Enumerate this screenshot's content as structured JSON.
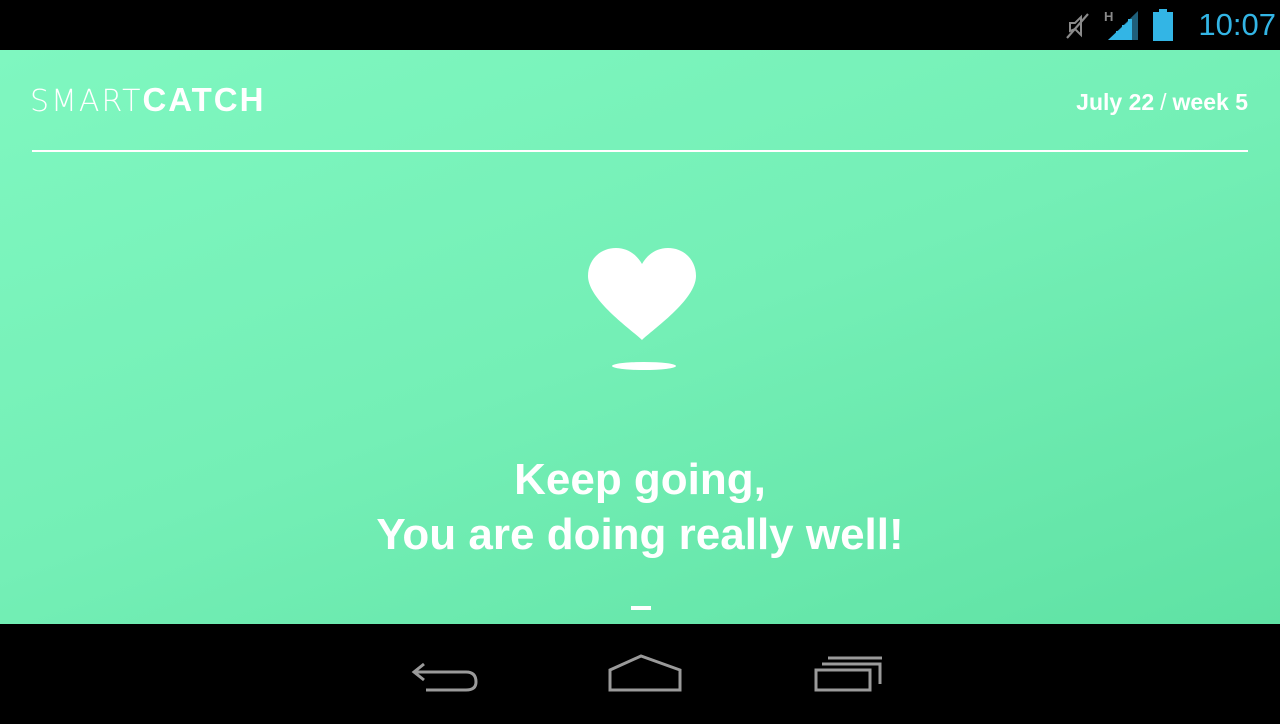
{
  "status_bar": {
    "time": "10:07",
    "network_type": "H",
    "icons": [
      "mute-icon",
      "signal-icon",
      "battery-icon"
    ],
    "clock_color": "#33b5e5"
  },
  "app": {
    "brand": {
      "part_light": "SMART",
      "part_bold": "CATCH"
    },
    "date": {
      "day": "July 22",
      "separator": "/",
      "week": "week 5"
    },
    "message": {
      "line1": "Keep going,",
      "line2": "You are doing really well!"
    },
    "icon": "heart-icon",
    "colors": {
      "background_start": "#7ff7c0",
      "background_end": "#5fe2a4",
      "foreground": "#ffffff"
    }
  },
  "nav_bar": {
    "buttons": [
      "back-icon",
      "home-icon",
      "recents-icon"
    ]
  }
}
